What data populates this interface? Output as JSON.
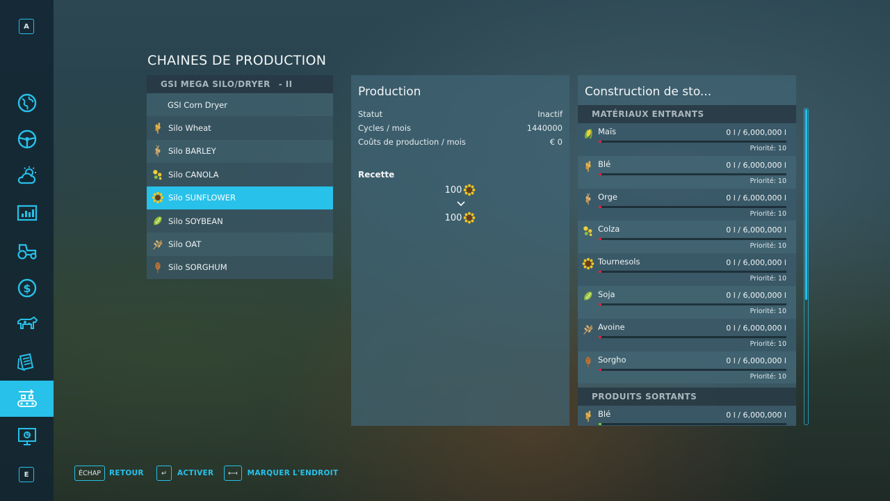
{
  "nav": {
    "key_top": "A",
    "key_bottom": "E",
    "items": [
      {
        "icon": "globe-map-icon"
      },
      {
        "icon": "steering-wheel-icon"
      },
      {
        "icon": "weather-icon"
      },
      {
        "icon": "statistics-icon"
      },
      {
        "icon": "tractor-icon"
      },
      {
        "icon": "finance-icon"
      },
      {
        "icon": "animals-icon"
      },
      {
        "icon": "contracts-icon"
      },
      {
        "icon": "production-chains-icon",
        "active": true
      },
      {
        "icon": "help-icon"
      }
    ],
    "accent": "#27c1ea"
  },
  "page_title": "CHAINES DE PRODUCTION",
  "production_list": {
    "header": "GSI MEGA SILO/DRYER",
    "header_suffix": "- II",
    "items": [
      {
        "label": "GSI Corn Dryer",
        "icon": ""
      },
      {
        "label": "Silo Wheat",
        "icon": "wheat-icon"
      },
      {
        "label": "Silo BARLEY",
        "icon": "barley-icon"
      },
      {
        "label": "Silo CANOLA",
        "icon": "canola-icon"
      },
      {
        "label": "Silo SUNFLOWER",
        "icon": "sunflower-icon",
        "selected": true
      },
      {
        "label": "Silo SOYBEAN",
        "icon": "soybean-icon"
      },
      {
        "label": "Silo OAT",
        "icon": "oat-icon"
      },
      {
        "label": "Silo SORGHUM",
        "icon": "sorghum-icon"
      }
    ]
  },
  "production": {
    "title": "Production",
    "status_label": "Statut",
    "status_value": "Inactif",
    "cycles_label": "Cycles / mois",
    "cycles_value": "1440000",
    "cost_label": "Coûts de production / mois",
    "cost_value": "€ 0",
    "recipe_label": "Recette",
    "recipe_input": "100",
    "recipe_output": "100"
  },
  "storage": {
    "title": "Construction de sto...",
    "inputs_header": "MATÉRIAUX ENTRANTS",
    "outputs_header": "PRODUITS SORTANTS",
    "inputs": [
      {
        "name": "Maïs",
        "amount": "0 l / 6,000,000 l",
        "priority": "Priorité: 10",
        "icon": "corn-icon"
      },
      {
        "name": "Blé",
        "amount": "0 l / 6,000,000 l",
        "priority": "Priorité: 10",
        "icon": "wheat-icon"
      },
      {
        "name": "Orge",
        "amount": "0 l / 6,000,000 l",
        "priority": "Priorité: 10",
        "icon": "barley-icon"
      },
      {
        "name": "Colza",
        "amount": "0 l / 6,000,000 l",
        "priority": "Priorité: 10",
        "icon": "canola-icon"
      },
      {
        "name": "Tournesols",
        "amount": "0 l / 6,000,000 l",
        "priority": "Priorité: 10",
        "icon": "sunflower-icon"
      },
      {
        "name": "Soja",
        "amount": "0 l / 6,000,000 l",
        "priority": "Priorité: 10",
        "icon": "soybean-icon"
      },
      {
        "name": "Avoine",
        "amount": "0 l / 6,000,000 l",
        "priority": "Priorité: 10",
        "icon": "oat-icon"
      },
      {
        "name": "Sorgho",
        "amount": "0 l / 6,000,000 l",
        "priority": "Priorité: 10",
        "icon": "sorghum-icon"
      }
    ],
    "outputs": [
      {
        "name": "Blé",
        "amount": "0 l / 6,000,000 l",
        "icon": "wheat-icon"
      }
    ],
    "bar_empty_color": "#e0233a",
    "bar_output_color": "#6ad12a"
  },
  "footer": {
    "back_key": "ÉCHAP",
    "back_label": "RETOUR",
    "activate_key": "↵",
    "activate_label": "ACTIVER",
    "mark_key": "⟻",
    "mark_label": "MARQUER L'ENDROIT"
  }
}
